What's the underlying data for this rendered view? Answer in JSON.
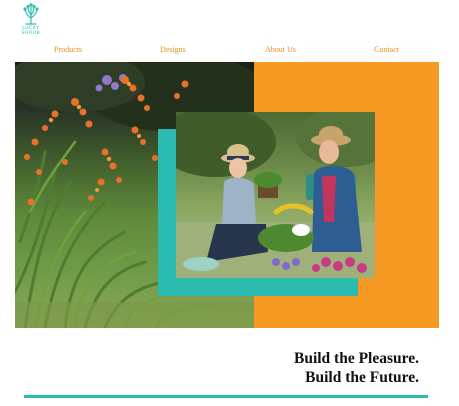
{
  "brand": {
    "name_line1": "LUCKY",
    "name_line2": "SHRUB",
    "color": "#2fbfb0"
  },
  "nav": {
    "items": [
      {
        "label": "Products"
      },
      {
        "label": "Designs"
      },
      {
        "label": "About Us"
      },
      {
        "label": "Contact"
      }
    ],
    "color": "#e8901c"
  },
  "hero": {
    "accent_orange": "#f79a24",
    "accent_teal": "#2bbbb0",
    "left_image": "garden-flowers-image",
    "right_image": "mother-daughter-gardening-image"
  },
  "tagline": {
    "line1": "Build the Pleasure.",
    "line2": "Build the Future."
  }
}
